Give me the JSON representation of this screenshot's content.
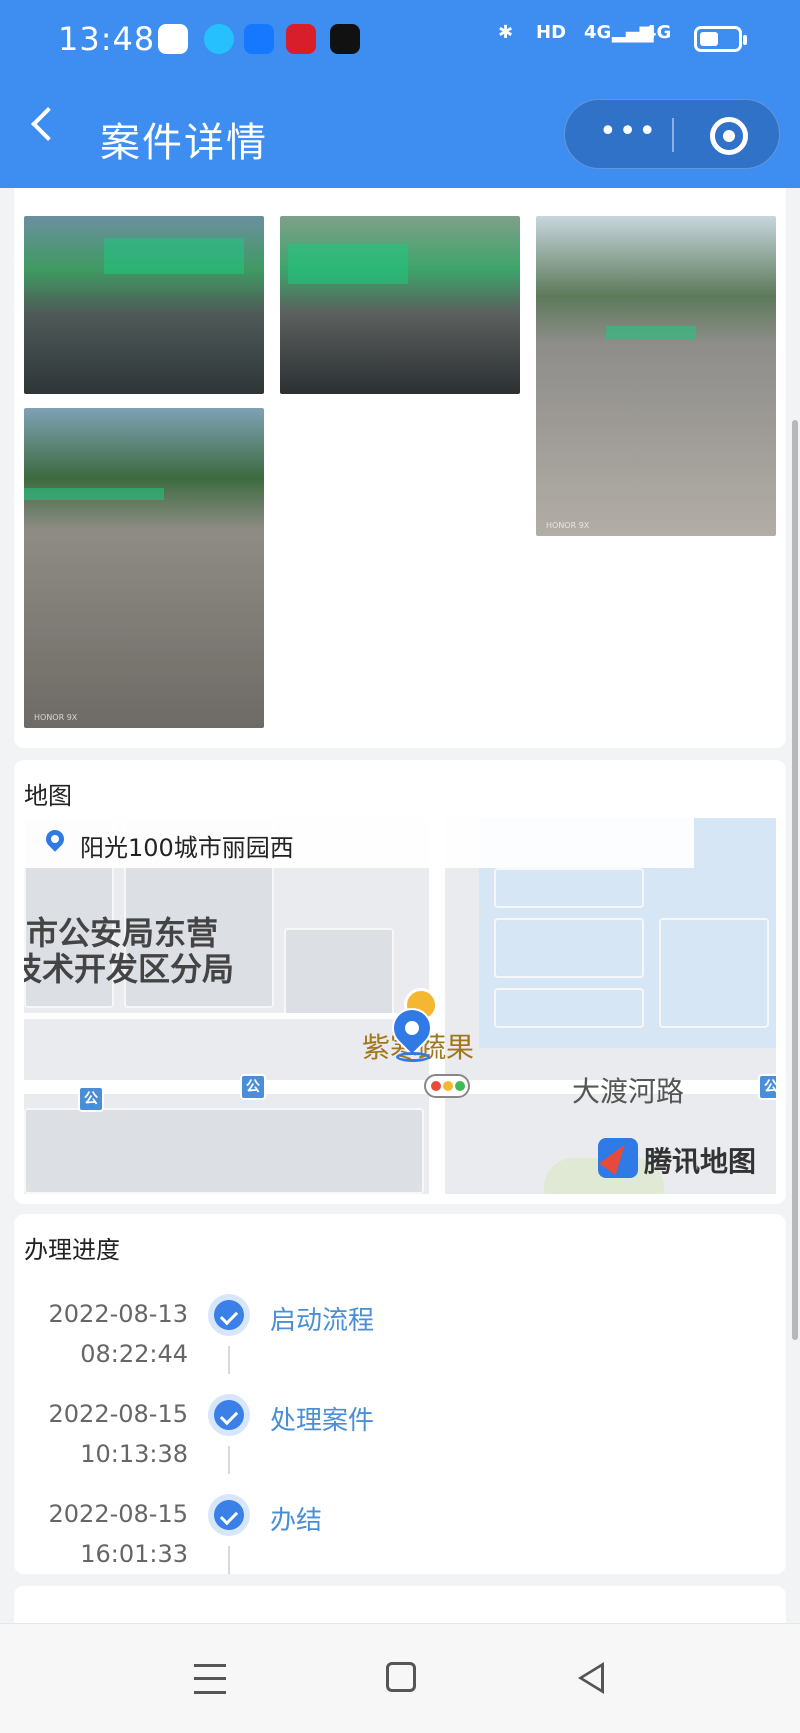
{
  "status_bar": {
    "time": "13:48",
    "network_1": "4G",
    "network_2": "4G",
    "hd": "HD"
  },
  "header": {
    "title": "案件详情",
    "back_icon": "chevron-left-icon",
    "more_icon": "more-dots-icon",
    "close_icon": "target-circle-icon"
  },
  "photos": {
    "items": [
      "photo-1",
      "photo-2",
      "photo-3",
      "photo-4"
    ],
    "watermark": "HONOR 9X"
  },
  "map_section": {
    "title": "地图",
    "address": "阳光100城市丽园西",
    "labels": {
      "police_line1": "市公安局东营",
      "police_line2": "技术开发区分局",
      "poi": "紫寒蔬果",
      "road": "大渡河路",
      "provider": "腾讯地图"
    },
    "bus_icon": "公"
  },
  "progress_section": {
    "title": "办理进度",
    "steps": [
      {
        "date": "2022-08-13",
        "time": "08:22:44",
        "label": "启动流程"
      },
      {
        "date": "2022-08-15",
        "time": "10:13:38",
        "label": "处理案件"
      },
      {
        "date": "2022-08-15",
        "time": "16:01:33",
        "label": "办结"
      }
    ]
  },
  "colors": {
    "brand_blue": "#3d8ef0",
    "step_blue": "#3b7fe8",
    "link_blue": "#4a8fd6"
  }
}
